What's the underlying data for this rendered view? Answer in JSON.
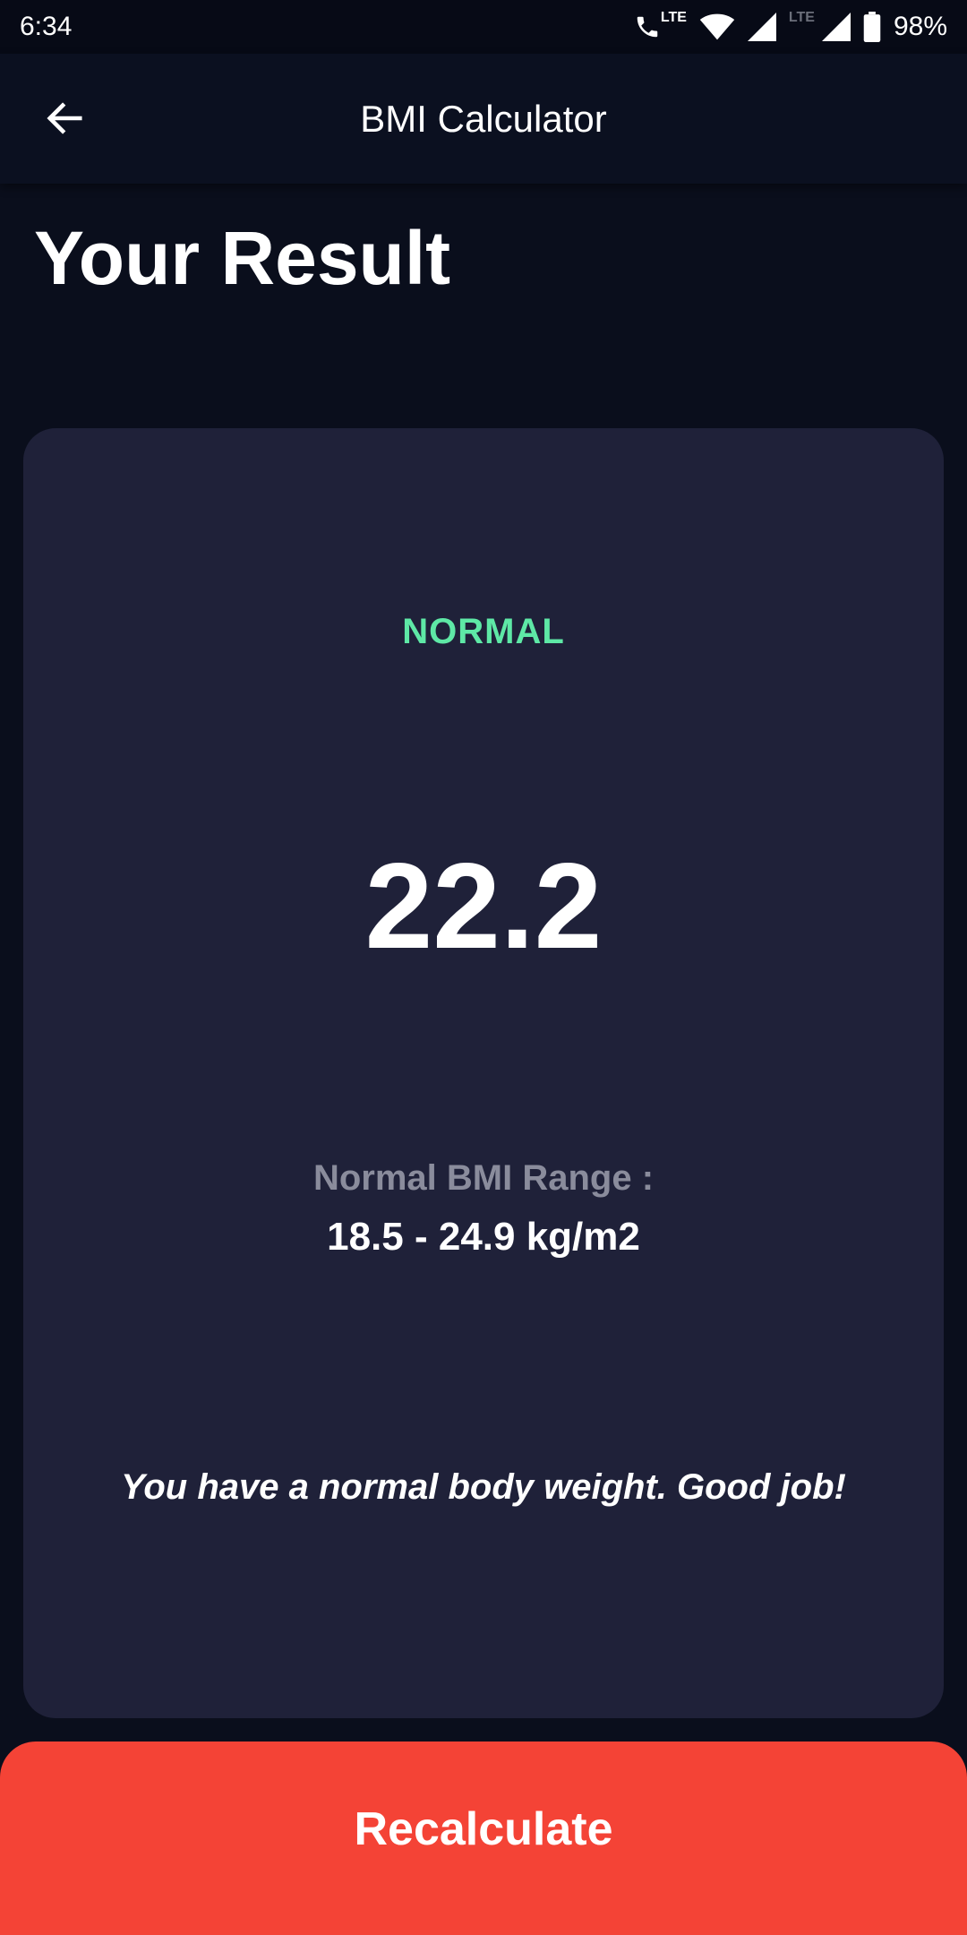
{
  "status_bar": {
    "time": "6:34",
    "lte_label_1": "LTE",
    "lte_label_2": "LTE",
    "battery": "98%"
  },
  "app_bar": {
    "title": "BMI Calculator",
    "back_icon": "arrow-left-icon"
  },
  "page": {
    "title": "Your Result"
  },
  "result": {
    "status": "NORMAL",
    "bmi": "22.2",
    "range_label": "Normal BMI Range :",
    "range_value": "18.5 - 24.9 kg/m2",
    "message": "You have a normal body weight. Good job!"
  },
  "button": {
    "recalculate_label": "Recalculate"
  },
  "colors": {
    "background": "#0a0e1c",
    "card": "#1f2139",
    "status_green": "#5ee8a6",
    "button_red": "#f44336"
  }
}
